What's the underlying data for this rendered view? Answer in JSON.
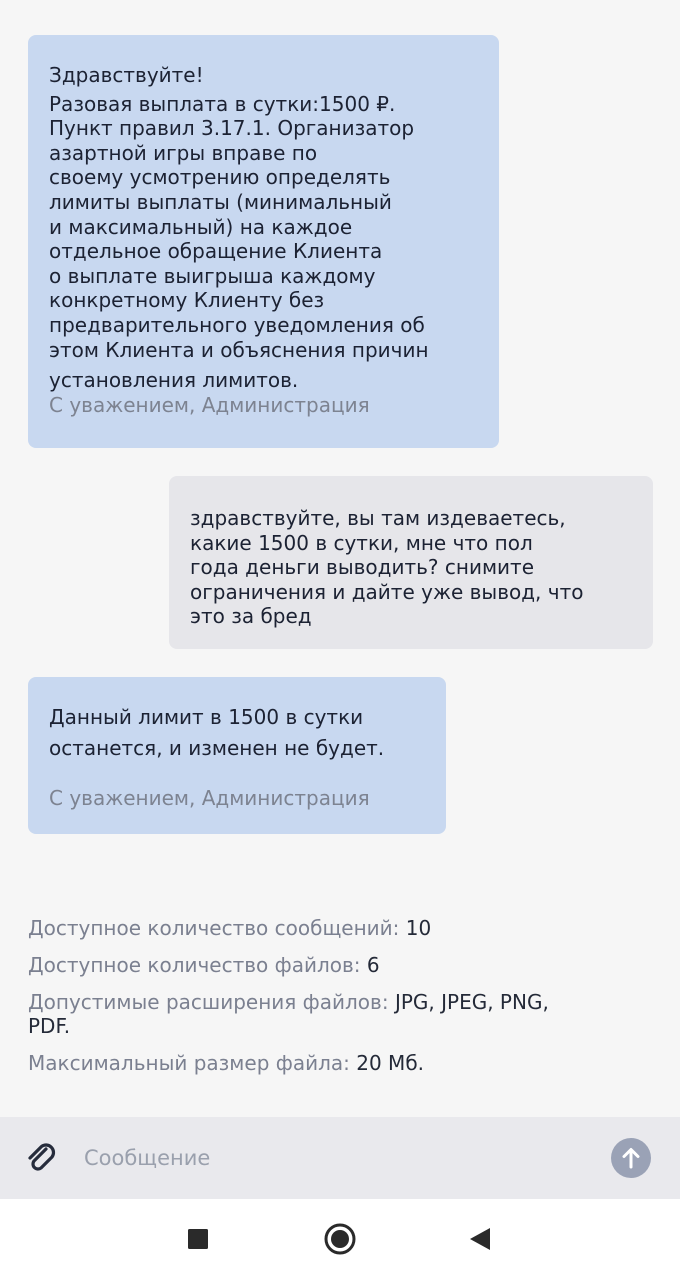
{
  "messages": [
    {
      "sender": "admin",
      "lines": [
        "Здравствуйте!",
        "Разовая выплата в сутки:1500 ₽.",
        "Пункт правил 3.17.1. Организатор",
        "азартной игры вправе по",
        "своему усмотрению определять",
        "лимиты выплаты (минимальный",
        "и максимальный) на каждое",
        "отдельное обращение Клиента",
        "о выплате выигрыша каждому",
        "конкретному Клиенту без",
        "предварительного уведомления об",
        "этом Клиента и объяснения причин",
        "установления лимитов."
      ],
      "signature": "С уважением, Администрация"
    },
    {
      "sender": "user",
      "lines": [
        "здравствуйте, вы там издеваетесь,",
        "какие 1500 в сутки, мне что пол",
        "года деньги выводить? снимите",
        "ограничения и дайте уже вывод, что",
        "это за бред"
      ]
    },
    {
      "sender": "admin",
      "lines": [
        "Данный лимит в 1500 в сутки",
        "останется, и изменен не будет."
      ],
      "signature": "С уважением, Администрация"
    }
  ],
  "info": {
    "messages_label": "Доступное количество сообщений:",
    "messages_value": "10",
    "files_label": "Доступное количество файлов:",
    "files_value": "6",
    "extensions_label": "Допустимые расширения файлов:",
    "extensions_value_line1": "JPG, JPEG, PNG,",
    "extensions_value_line2": "PDF.",
    "max_size_label": "Максимальный размер файла:",
    "max_size_value": "20 Мб."
  },
  "input": {
    "placeholder": "Сообщение",
    "attach_icon": "paperclip-icon",
    "send_icon": "arrow-up-icon"
  },
  "navbar": {
    "recents_icon": "square-icon",
    "home_icon": "circle-icon",
    "back_icon": "triangle-back-icon"
  },
  "colors": {
    "admin_bubble": "#c8d8f0",
    "user_bubble": "#e6e6ea",
    "send_button": "#9aa2b6",
    "background": "#f6f6f6"
  }
}
